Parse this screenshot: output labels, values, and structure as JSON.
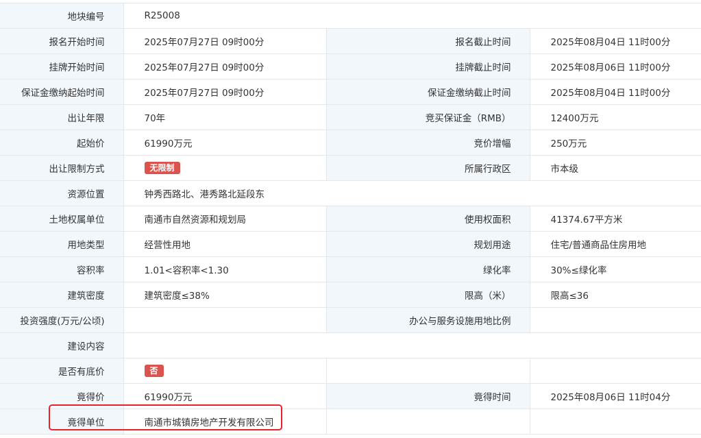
{
  "rows": {
    "r0": {
      "label": "地块编号",
      "value": "R25008"
    },
    "r1": {
      "label1": "报名开始时间",
      "value1": "2025年07月27日 09时00分",
      "label2": "报名截止时间",
      "value2": "2025年08月04日 11时00分"
    },
    "r2": {
      "label1": "挂牌开始时间",
      "value1": "2025年07月27日 09时00分",
      "label2": "挂牌截止时间",
      "value2": "2025年08月06日 11时00分"
    },
    "r3": {
      "label1": "保证金缴纳起始时间",
      "value1": "2025年07月27日 09时00分",
      "label2": "保证金缴纳截止时间",
      "value2": "2025年08月04日 11时00分"
    },
    "r4": {
      "label1": "出让年限",
      "value1": "70年",
      "label2": "竞买保证金（RMB）",
      "value2": "12400万元"
    },
    "r5": {
      "label1": "起始价",
      "value1": "61990万元",
      "label2": "竞价增幅",
      "value2": "250万元"
    },
    "r6": {
      "label1": "出让限制方式",
      "tag": "无限制",
      "label2": "所属行政区",
      "value2": "市本级"
    },
    "r7": {
      "label": "资源位置",
      "value": "钟秀西路北、港秀路北延段东"
    },
    "r8": {
      "label1": "土地权属单位",
      "value1": "南通市自然资源和规划局",
      "label2": "使用权面积",
      "value2": "41374.67平方米"
    },
    "r9": {
      "label1": "用地类型",
      "value1": "经营性用地",
      "label2": "规划用途",
      "value2": "住宅/普通商品住房用地"
    },
    "r10": {
      "label1": "容积率",
      "value1": "1.01<容积率<1.30",
      "label2": "绿化率",
      "value2": "30%≤绿化率"
    },
    "r11": {
      "label1": "建筑密度",
      "value1": "建筑密度≤38%",
      "label2": "限高（米）",
      "value2": "限高≤36"
    },
    "r12": {
      "label1": "投资强度(万元/公顷)",
      "value1": "",
      "label2": "办公与服务设施用地比例",
      "value2": ""
    },
    "r13": {
      "label": "建设内容",
      "value": ""
    },
    "r14": {
      "label1": "是否有底价",
      "tag": "否",
      "label2": "",
      "value2": ""
    },
    "r15": {
      "label1": "竟得价",
      "value1": "61990万元",
      "label2": "竟得时间",
      "value2": "2025年08月06日 11时04分"
    },
    "r16": {
      "label1": "竟得单位",
      "value1": "南通市城镇房地产开发有限公司",
      "label2": "",
      "value2": ""
    }
  },
  "colors": {
    "label_bg": "#f2f7fc",
    "border": "#e3e7ec",
    "tag_red": "#d9534f",
    "highlight": "#e8222a"
  }
}
